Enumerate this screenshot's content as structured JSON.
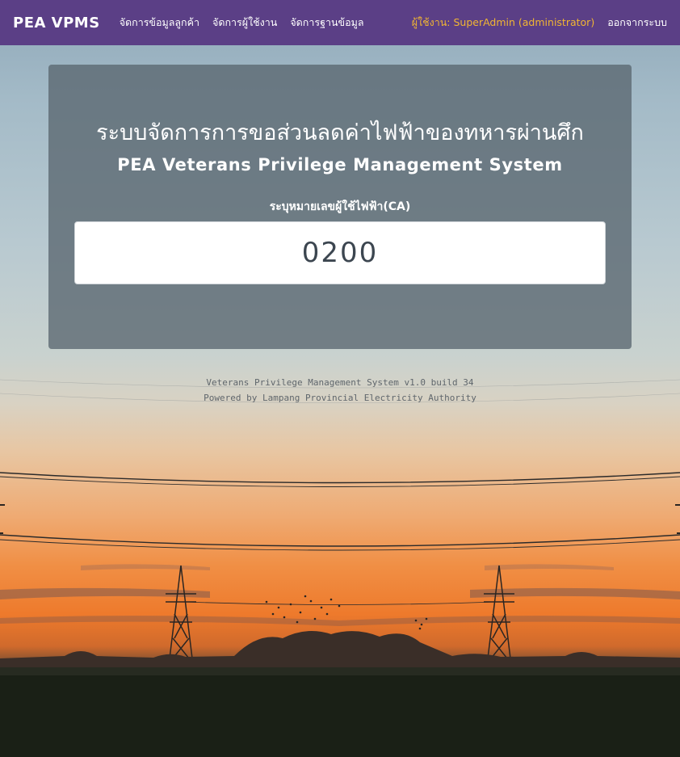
{
  "navbar": {
    "brand": "PEA VPMS",
    "links": [
      {
        "label": "จัดการข้อมูลลูกค้า"
      },
      {
        "label": "จัดการผู้ใช้งาน"
      },
      {
        "label": "จัดการฐานข้อมูล"
      }
    ],
    "user": "ผู้ใช้งาน: SuperAdmin (administrator)",
    "logout": "ออกจากระบบ"
  },
  "main": {
    "title_th": "ระบบจัดการการขอส่วนลดค่าไฟฟ้าของทหารผ่านศึก",
    "title_en": "PEA Veterans Privilege Management System",
    "ca_label": "ระบุหมายเลขผู้ใช้ไฟฟ้า(CA)",
    "ca_value": "0200"
  },
  "footer": {
    "line1": "Veterans Privilege Management System v1.0 build 34",
    "line2": "Powered by Lampang Provincial Electricity Authority"
  },
  "colors": {
    "navbar_bg": "#5b3f86",
    "user_text": "#f2b632",
    "panel_bg": "#5a6670"
  }
}
